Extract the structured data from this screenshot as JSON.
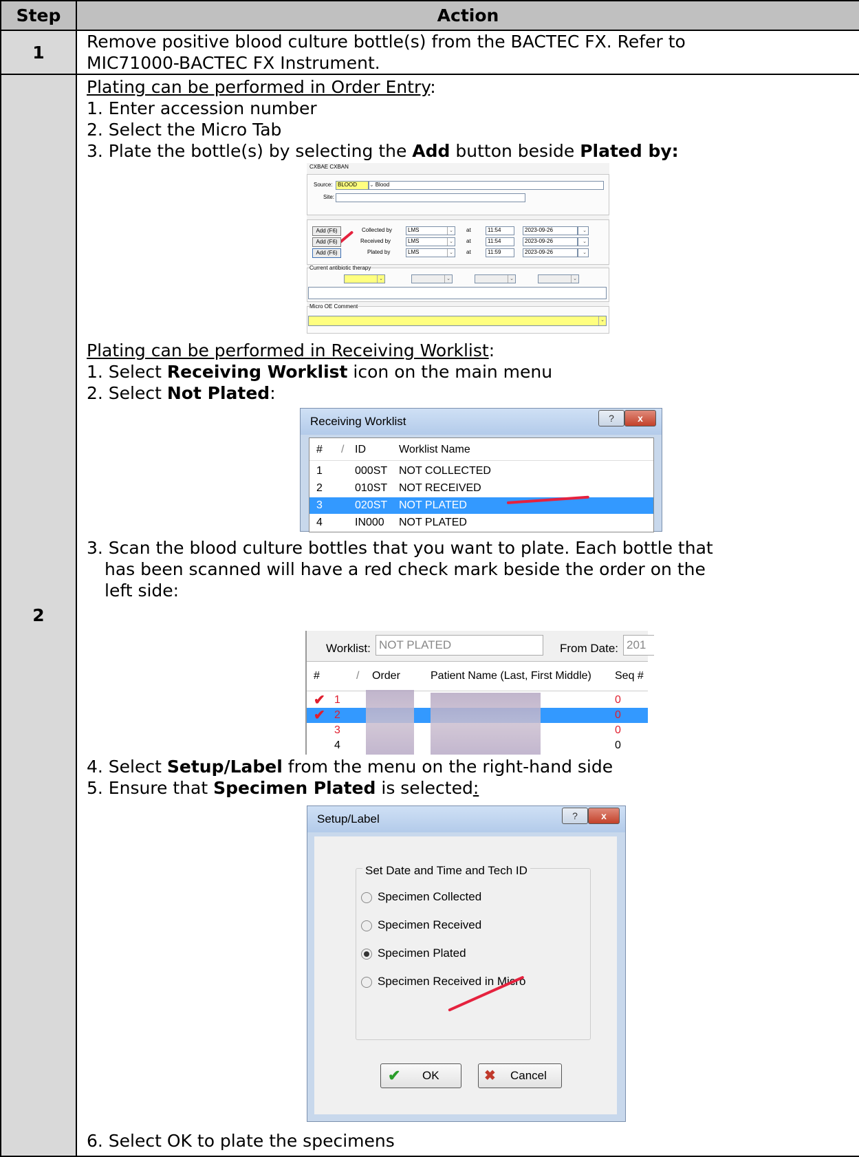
{
  "table": {
    "header_step": "Step",
    "header_action": "Action"
  },
  "step1": {
    "number": "1",
    "line1": "Remove positive blood culture bottle(s) from the BACTEC FX. Refer to",
    "line2": "MIC71000-BACTEC FX Instrument."
  },
  "step2": {
    "number": "2",
    "oe_heading": "Plating can be performed in Order Entry",
    "oe_items": [
      "1. Enter accession number",
      "2. Select the Micro Tab"
    ],
    "oe_item3_pre": "3. Plate the bottle(s) by selecting the ",
    "oe_item3_bold1": "Add",
    "oe_item3_mid": " button beside ",
    "oe_item3_bold2": "Plated by:",
    "rw_heading": "Plating can be performed in Receiving Worklist",
    "rw_item1_pre": "1. Select ",
    "rw_item1_bold": "Receiving Worklist",
    "rw_item1_post": " icon on the main menu",
    "rw_item2_pre": "2. Select ",
    "rw_item2_bold": "Not Plated",
    "rw_item3_l1": "3. Scan the blood culture bottles that you want to plate. Each bottle that",
    "rw_item3_l2": "has been scanned will have a red check mark beside the order on the",
    "rw_item3_l3": "left side:",
    "rw_item4_pre": "4. Select ",
    "rw_item4_bold": "Setup/Label",
    "rw_item4_post": " from the menu on the right-hand side",
    "rw_item5_pre": "5. Ensure that ",
    "rw_item5_bold": "Specimen Plated",
    "rw_item5_post": " is selected",
    "rw_item6": "6. Select OK to plate the specimens"
  },
  "order_entry": {
    "codes": "CXBAE CXBAN",
    "source_label": "Source:",
    "source_value": "BLOOD",
    "source_desc": "Blood",
    "site_label": "Site:",
    "add_label": "Add (F6)",
    "rows": [
      {
        "label": "Collected by",
        "tech": "LMS",
        "at": "at",
        "time": "11:54",
        "date": "2023-09-26"
      },
      {
        "label": "Received by",
        "tech": "LMS",
        "at": "at",
        "time": "11:54",
        "date": "2023-09-26"
      },
      {
        "label": "Plated by",
        "tech": "LMS",
        "at": "at",
        "time": "11:59",
        "date": "2023-09-26"
      }
    ],
    "antibiotic_label": "Current antibiotic therapy",
    "comment_label": "Micro OE Comment"
  },
  "receiving_worklist": {
    "title": "Receiving Worklist",
    "help": "?",
    "close": "x",
    "columns": [
      "#",
      "/",
      "ID",
      "Worklist Name"
    ],
    "rows": [
      {
        "num": "1",
        "id": "000ST",
        "name": "NOT COLLECTED"
      },
      {
        "num": "2",
        "id": "010ST",
        "name": "NOT RECEIVED"
      },
      {
        "num": "3",
        "id": "020ST",
        "name": "NOT PLATED"
      },
      {
        "num": "4",
        "id": "IN000",
        "name": "NOT PLATED"
      }
    ]
  },
  "worklist_grid": {
    "worklist_label": "Worklist:",
    "worklist_value": "NOT PLATED",
    "from_label": "From Date:",
    "from_value": "201",
    "columns": [
      "#",
      "/",
      "Order",
      "Patient Name (Last, First Middle)",
      "Seq #"
    ],
    "rows": [
      {
        "num": "1",
        "seq": "0"
      },
      {
        "num": "2",
        "seq": "0"
      },
      {
        "num": "3",
        "seq": "0"
      },
      {
        "num": "4",
        "seq": "0"
      }
    ]
  },
  "setup_label": {
    "title": "Setup/Label",
    "help": "?",
    "close": "x",
    "group": "Set Date and Time and Tech ID",
    "options": [
      "Specimen Collected",
      "Specimen Received",
      "Specimen Plated",
      "Specimen Received in Micro"
    ],
    "ok": "OK",
    "cancel": "Cancel"
  }
}
